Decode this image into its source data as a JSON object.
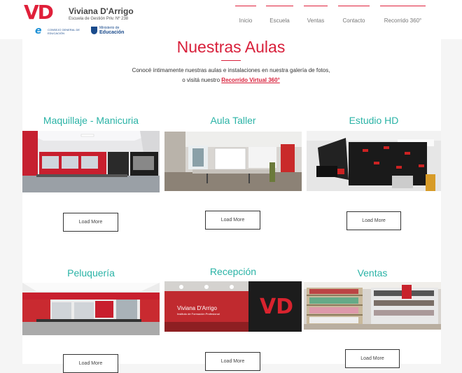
{
  "brand": {
    "logo": "VD",
    "name": "Viviana D'Arrigo",
    "subtitle": "Escuela de Gestión Priv. Nº 238",
    "cge_text": "CONSEJO GENERAL DE EDUCACIÓN",
    "ministry_small": "Ministerio de",
    "ministry_big": "Educación"
  },
  "nav": [
    "Inicio",
    "Escuela",
    "Ventas",
    "Contacto",
    "Recorrido 360°"
  ],
  "page": {
    "title": "Nuestras Aulas",
    "intro_line1": "Conocé íntimamente nuestras aulas e instalaciones en nuestra galería de fotos,",
    "intro_line2_prefix": "o visitá nuestro ",
    "intro_link": "Recorrido Virtual 360°"
  },
  "rooms": [
    {
      "title": "Maquillaje - Manicuria",
      "button": "Load More"
    },
    {
      "title": "Aula Taller",
      "button": "Load More"
    },
    {
      "title": "Estudio HD",
      "button": "Load More"
    },
    {
      "title": "Peluquería",
      "button": "Load More"
    },
    {
      "title": "Recepción",
      "button": "Load More",
      "sign_text": "Viviana D'Arrigo",
      "sign_sub": "Instituto de Formación Profesional"
    },
    {
      "title": "Ventas",
      "button": "Load More"
    }
  ],
  "colors": {
    "accent": "#d81f3a",
    "teal": "#2ab3a6"
  }
}
